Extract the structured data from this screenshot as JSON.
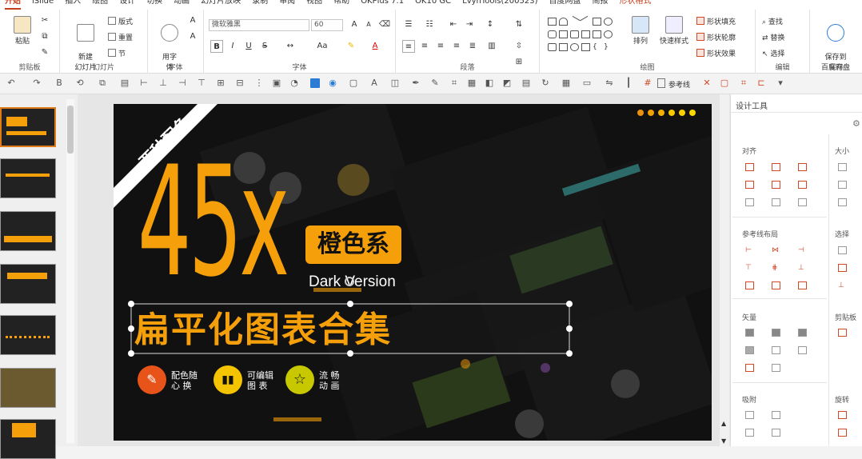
{
  "tabs": [
    "开始",
    "iSlide",
    "插入",
    "绘图",
    "设计",
    "切换",
    "动画",
    "幻灯片放映",
    "录制",
    "审阅",
    "视图",
    "帮助",
    "OKPlus 7.1",
    "OK10 GC",
    "LvyhTools(200523)",
    "百度网盘",
    "简报",
    "形状格式"
  ],
  "ribbon": {
    "clipboard": {
      "label": "剪贴板",
      "paste": "粘贴"
    },
    "slides": {
      "label": "幻灯片",
      "new_slide": "新建\n幻灯片",
      "layout": "版式",
      "reset": "重置",
      "section": "节"
    },
    "font_group": {
      "label": "字体",
      "use_font": "用字\n体"
    },
    "font": {
      "label": "字体",
      "name": "微软雅黑",
      "size": "60",
      "bold": "B",
      "italic": "I",
      "underline": "U",
      "strike": "S",
      "grow": "A",
      "shrink": "A",
      "case": "Aa"
    },
    "paragraph": {
      "label": "段落"
    },
    "drawing": {
      "label": "绘图",
      "arrange": "排列",
      "quick_styles": "快速样式",
      "fill": "形状填充",
      "outline": "形状轮廓",
      "effects": "形状效果"
    },
    "editing": {
      "label": "编辑",
      "find": "查找",
      "replace": "替换",
      "select": "选择"
    },
    "save": {
      "label": "保存",
      "save_to": "保存到\n百度网盘"
    }
  },
  "qat": {
    "ref_line": "参考线"
  },
  "slide": {
    "corner_tag": "两种配色",
    "big_number": "45x",
    "badge": "橙色系",
    "subtitle": "Dark Version",
    "main_title": "扁平化图表合集",
    "features": [
      {
        "text": "配色随\n心  换"
      },
      {
        "text": "可编辑\n图  表"
      },
      {
        "text": "流  畅\n动  画"
      }
    ],
    "dots": [
      "#e8920f",
      "#f0a000",
      "#f5b000",
      "#f8c800",
      "#fad000",
      "#fbd800"
    ]
  },
  "panel": {
    "title": "设计工具",
    "sections": [
      "对齐",
      "大小",
      "参考线布局",
      "选择",
      "矢量",
      "剪贴板",
      "吸附",
      "旋转"
    ]
  },
  "colors": {
    "accent": "#f5a00a",
    "ribbon_accent": "#c43e1c"
  }
}
